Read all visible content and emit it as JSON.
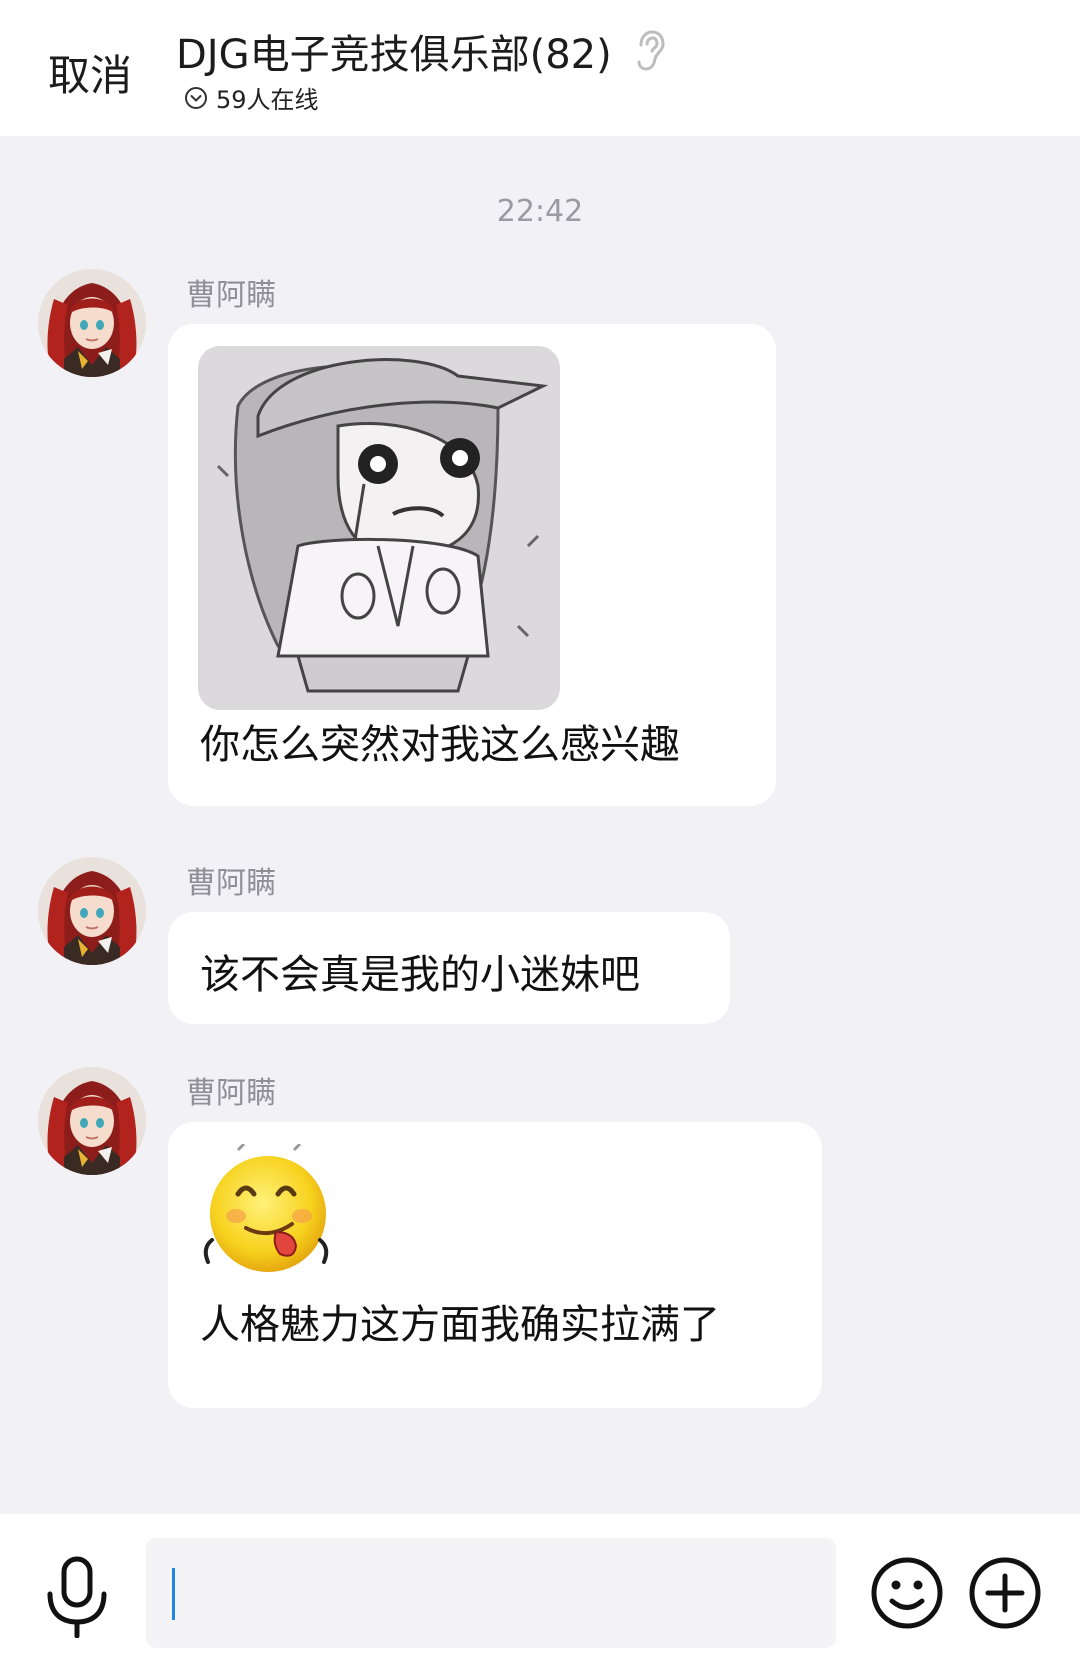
{
  "header": {
    "cancel_label": "取消",
    "title": "DJG电子竞技俱乐部(82)",
    "online": "59人在线",
    "icons": [
      "ear-icon",
      "chevron-circle-icon"
    ]
  },
  "chat": {
    "timestamp": "22:42",
    "messages": [
      {
        "sender": "曹阿瞒",
        "avatar_icon": "anime-avatar",
        "sticker": "crying-girl-sticker",
        "text": "你怎么突然对我这么感兴趣"
      },
      {
        "sender": "曹阿瞒",
        "avatar_icon": "anime-avatar",
        "text": "该不会真是我的小迷妹吧"
      },
      {
        "sender": "曹阿瞒",
        "avatar_icon": "anime-avatar",
        "sticker": "tongue-out-emoji-sticker",
        "text": "人格魅力这方面我确实拉满了"
      }
    ]
  },
  "input_bar": {
    "text_value": "",
    "icons": [
      "microphone-icon",
      "emoji-icon",
      "plus-icon"
    ]
  },
  "colors": {
    "chat_background": "#f2f1f6",
    "bubble": "#ffffff",
    "caret": "#1e88e5"
  }
}
